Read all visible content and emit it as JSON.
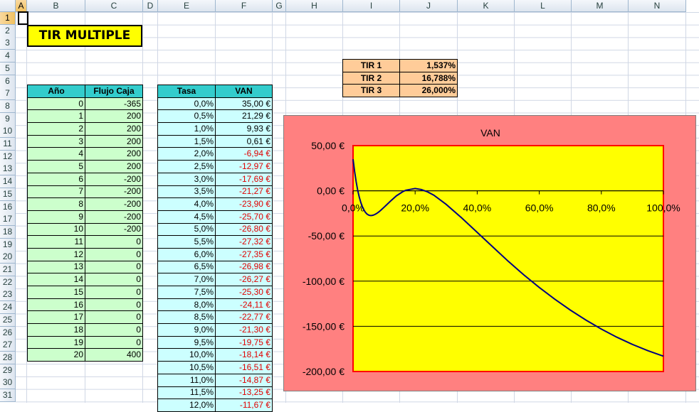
{
  "columns": [
    "A",
    "B",
    "C",
    "D",
    "E",
    "F",
    "G",
    "H",
    "I",
    "J",
    "K",
    "L",
    "M",
    "N"
  ],
  "rows": [
    "1",
    "2",
    "3",
    "4",
    "5",
    "6",
    "7",
    "8",
    "9",
    "10",
    "11",
    "12",
    "13",
    "14",
    "15",
    "16",
    "17",
    "18",
    "19",
    "20",
    "21",
    "22",
    "23",
    "24",
    "25",
    "26",
    "27",
    "28",
    "29",
    "30",
    "31"
  ],
  "title": "TIR MULTIPLE",
  "cash_table": {
    "headers": [
      "Año",
      "Flujo Caja"
    ],
    "years": [
      "0",
      "1",
      "2",
      "3",
      "4",
      "5",
      "6",
      "7",
      "8",
      "9",
      "10",
      "11",
      "12",
      "13",
      "14",
      "15",
      "16",
      "17",
      "18",
      "19",
      "20"
    ],
    "flows": [
      "-365",
      "200",
      "200",
      "200",
      "200",
      "200",
      "-200",
      "-200",
      "-200",
      "-200",
      "-200",
      "0",
      "0",
      "0",
      "0",
      "0",
      "0",
      "0",
      "0",
      "0",
      "400"
    ]
  },
  "rate_table": {
    "headers": [
      "Tasa",
      "VAN"
    ],
    "rates": [
      "0,0%",
      "0,5%",
      "1,0%",
      "1,5%",
      "2,0%",
      "2,5%",
      "3,0%",
      "3,5%",
      "4,0%",
      "4,5%",
      "5,0%",
      "5,5%",
      "6,0%",
      "6,5%",
      "7,0%",
      "7,5%",
      "8,0%",
      "8,5%",
      "9,0%",
      "9,5%",
      "10,0%",
      "10,5%",
      "11,0%",
      "11,5%",
      "12,0%"
    ],
    "van": [
      "35,00 €",
      "21,29 €",
      "9,93 €",
      "0,61 €",
      "-6,94 €",
      "-12,97 €",
      "-17,69 €",
      "-21,27 €",
      "-23,90 €",
      "-25,70 €",
      "-26,80 €",
      "-27,32 €",
      "-27,35 €",
      "-26,98 €",
      "-26,27 €",
      "-25,30 €",
      "-24,11 €",
      "-22,77 €",
      "-21,30 €",
      "-19,75 €",
      "-18,14 €",
      "-16,51 €",
      "-14,87 €",
      "-13,25 €",
      "-11,67 €"
    ]
  },
  "tir": [
    {
      "label": "TIR 1",
      "value": "1,537%"
    },
    {
      "label": "TIR 2",
      "value": "16,788%"
    },
    {
      "label": "TIR 3",
      "value": "26,000%"
    }
  ],
  "colors": {
    "chart_outer": "#ff8080",
    "plot_area": "#ffff00",
    "line": "#000080",
    "header_fill": "#33cccc",
    "year_fill": "#ccffcc",
    "rate_fill": "#ccffff",
    "tir_fill": "#ffcc99",
    "negative": "#e00000"
  },
  "chart_data": {
    "type": "line",
    "title": "VAN",
    "xlabel": "",
    "ylabel": "",
    "xlim": [
      0,
      1
    ],
    "ylim": [
      -200,
      50
    ],
    "x_ticks": [
      "0,0%",
      "20,0%",
      "40,0%",
      "60,0%",
      "80,0%",
      "100,0%"
    ],
    "y_ticks": [
      "50,00 €",
      "0,00 €",
      "-50,00 €",
      "-100,00 €",
      "-150,00 €",
      "-200,00 €"
    ],
    "grid": true,
    "series": [
      {
        "x": [
          0,
          0.005,
          0.01,
          0.015,
          0.02,
          0.025,
          0.03,
          0.035,
          0.04,
          0.045,
          0.05,
          0.055,
          0.06,
          0.065,
          0.07,
          0.075,
          0.08,
          0.085,
          0.09,
          0.095,
          0.1,
          0.105,
          0.11,
          0.115,
          0.12,
          0.14,
          0.16,
          0.17,
          0.2,
          0.22,
          0.24,
          0.26,
          0.3,
          0.35,
          0.4,
          0.45,
          0.5,
          0.55,
          0.6,
          0.65,
          0.7,
          0.75,
          0.8,
          0.85,
          0.9,
          0.95,
          1.0
        ],
        "values": [
          35,
          21.29,
          9.93,
          0.61,
          -6.94,
          -12.97,
          -17.69,
          -21.27,
          -23.9,
          -25.7,
          -26.8,
          -27.32,
          -27.35,
          -26.98,
          -26.27,
          -25.3,
          -24.11,
          -22.77,
          -21.3,
          -19.75,
          -18.14,
          -16.51,
          -14.87,
          -13.25,
          -11.67,
          -5.5,
          -1.0,
          0.6,
          2.5,
          1.3,
          -1.2,
          -4.8,
          -15,
          -30,
          -46,
          -62,
          -78,
          -93,
          -107,
          -120,
          -132,
          -143,
          -153,
          -162,
          -170,
          -177,
          -183
        ]
      }
    ]
  }
}
